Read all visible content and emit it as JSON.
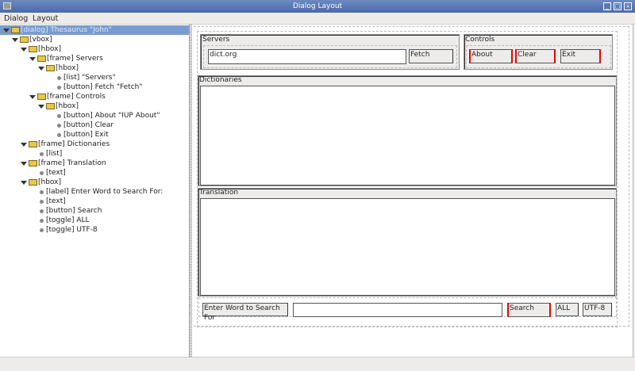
{
  "window": {
    "title": "Dialog Layout"
  },
  "menu": [
    {
      "label": "Dialog"
    },
    {
      "label": "Layout"
    }
  ],
  "tree": [
    {
      "label": "[dialog] Thesaurus \"John\"",
      "level": 0,
      "type": "folder",
      "selected": true
    },
    {
      "label": "[vbox]",
      "level": 1,
      "type": "folder"
    },
    {
      "label": "[hbox]",
      "level": 2,
      "type": "folder"
    },
    {
      "label": "[frame] Servers",
      "level": 3,
      "type": "folder"
    },
    {
      "label": "[hbox]",
      "level": 4,
      "type": "folder"
    },
    {
      "label": "[list] \"Servers\"",
      "level": 5,
      "type": "leaf"
    },
    {
      "label": "[button] Fetch \"Fetch\"",
      "level": 5,
      "type": "leaf"
    },
    {
      "label": "[frame] Controls",
      "level": 3,
      "type": "folder"
    },
    {
      "label": "[hbox]",
      "level": 4,
      "type": "folder"
    },
    {
      "label": "[button] About \"IUP About\"",
      "level": 5,
      "type": "leaf"
    },
    {
      "label": "[button] Clear",
      "level": 5,
      "type": "leaf"
    },
    {
      "label": "[button] Exit",
      "level": 5,
      "type": "leaf"
    },
    {
      "label": "[frame] Dictionaries",
      "level": 2,
      "type": "folder"
    },
    {
      "label": "[list]",
      "level": 3,
      "type": "leaf"
    },
    {
      "label": "[frame] Translation",
      "level": 2,
      "type": "folder"
    },
    {
      "label": "[text]",
      "level": 3,
      "type": "leaf"
    },
    {
      "label": "[hbox]",
      "level": 2,
      "type": "folder"
    },
    {
      "label": "[label] Enter Word to Search For:",
      "level": 3,
      "type": "leaf"
    },
    {
      "label": "[text]",
      "level": 3,
      "type": "leaf"
    },
    {
      "label": "[button] Search",
      "level": 3,
      "type": "leaf"
    },
    {
      "label": "[toggle] ALL",
      "level": 3,
      "type": "leaf"
    },
    {
      "label": "[toggle] UTF-8",
      "level": 3,
      "type": "leaf"
    }
  ],
  "preview": {
    "servers": {
      "title": "Servers",
      "value": "dict.org",
      "fetch": "Fetch"
    },
    "controls": {
      "title": "Controls",
      "about": "About",
      "clear": "Clear",
      "exit": "Exit"
    },
    "dictionaries": {
      "title": "Dictionaries"
    },
    "translation": {
      "title": "Translation"
    },
    "search": {
      "label": "Enter Word to Search For",
      "value": "",
      "button": "Search",
      "all": "ALL",
      "utf8": "UTF-8"
    }
  },
  "colors": {
    "selection": "#7a9bd0",
    "titlebar": "#5b79b2",
    "marker": "#e00000"
  }
}
